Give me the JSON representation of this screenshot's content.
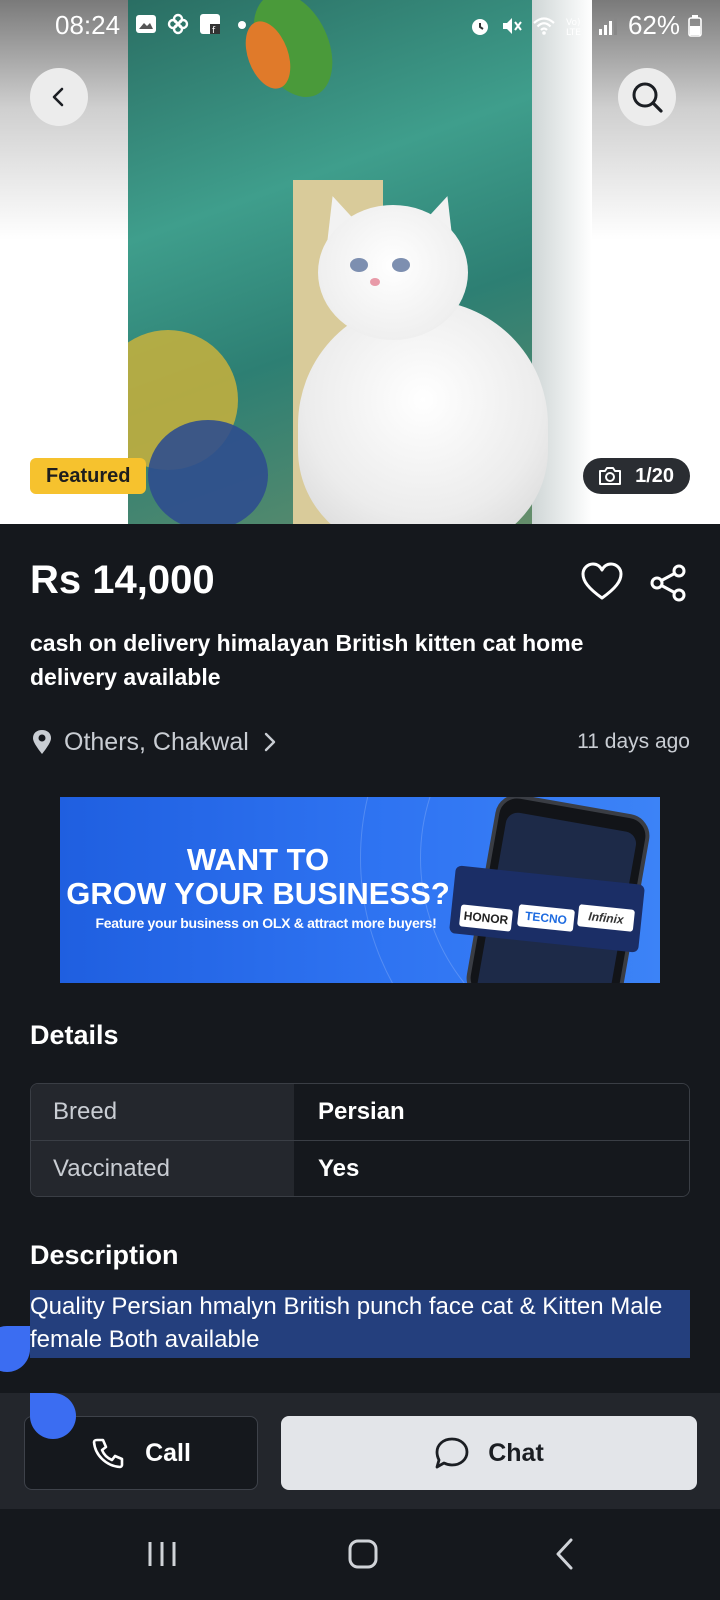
{
  "status_bar": {
    "time": "08:24",
    "battery": "62%",
    "left_icons": [
      "gallery-icon",
      "pinwheel-icon",
      "facebook-photo-icon",
      "dot-icon"
    ],
    "right_icons": [
      "alarm-icon",
      "mute-icon",
      "wifi-icon",
      "volte-icon",
      "signal-icon",
      "battery-icon"
    ]
  },
  "hero": {
    "featured_label": "Featured",
    "photo_count": "1/20"
  },
  "listing": {
    "price": "Rs 14,000",
    "title": "cash on delivery himalayan British kitten cat home delivery available",
    "location": "Others, Chakwal",
    "posted": "11 days ago"
  },
  "banner": {
    "headline_1": "WANT TO",
    "headline_2": "GROW YOUR BUSINESS?",
    "subline": "Feature your business on OLX & attract more buyers!",
    "brands": [
      "HONOR",
      "TECNO",
      "Infinix"
    ]
  },
  "details": {
    "title": "Details",
    "rows": [
      {
        "key": "Breed",
        "value": "Persian"
      },
      {
        "key": "Vaccinated",
        "value": "Yes"
      }
    ]
  },
  "description": {
    "title": "Description",
    "text": "Quality Persian hmalyn British punch face cat & Kitten Male female Both available"
  },
  "actions": {
    "call_label": "Call",
    "chat_label": "Chat"
  },
  "colors": {
    "background": "#15181d",
    "featured": "#f6c22e",
    "selection": "#243f7d",
    "banner": "#2f74f2"
  }
}
